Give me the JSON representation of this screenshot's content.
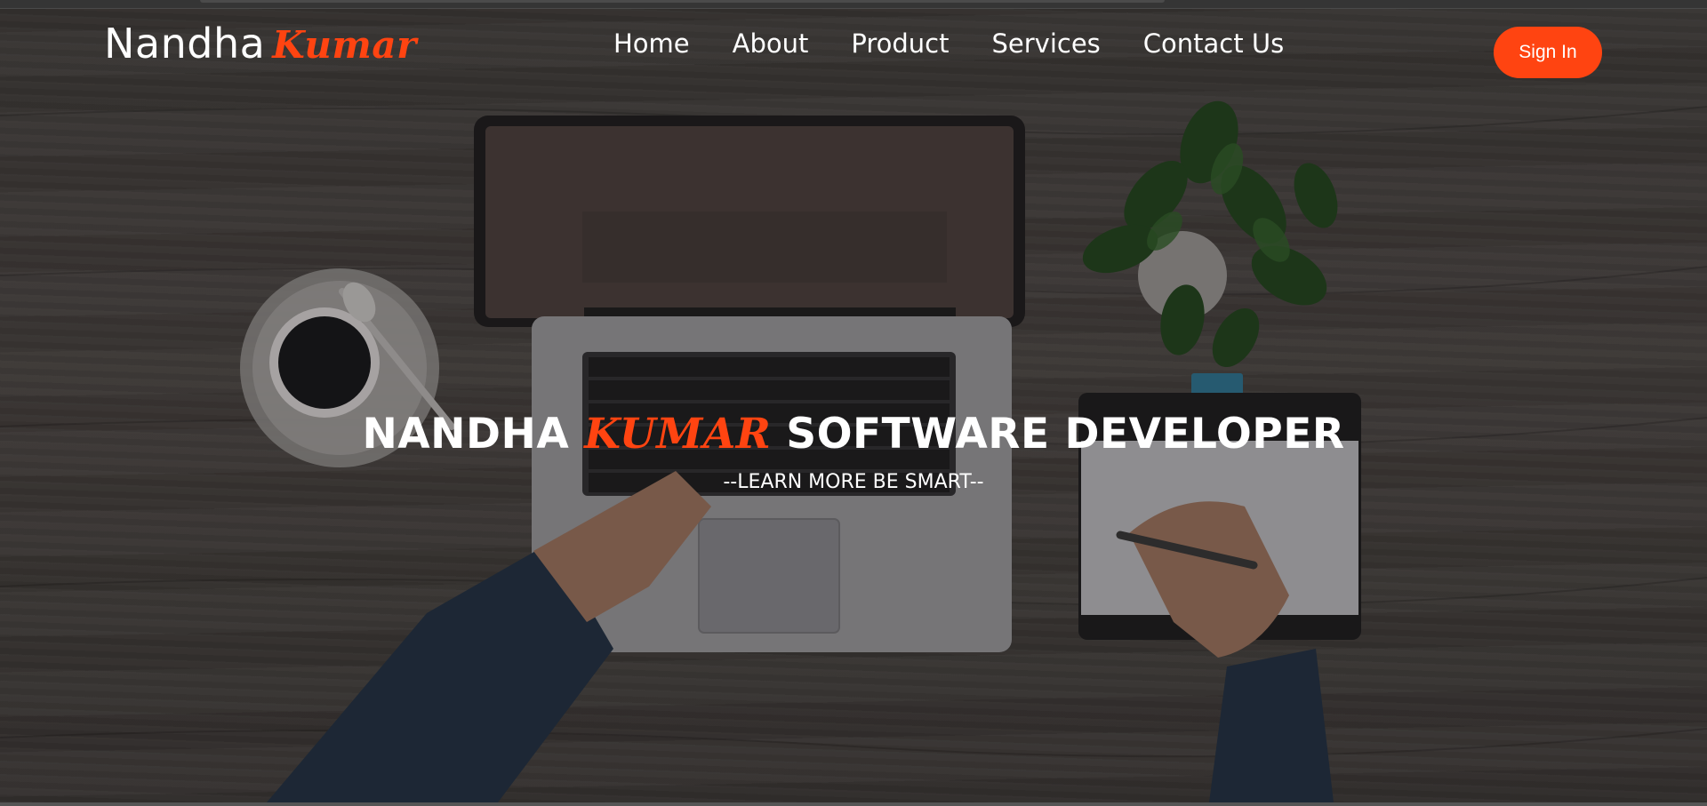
{
  "brand": {
    "first_name": "Nandha",
    "last_name": "Kumar"
  },
  "nav": {
    "items": [
      {
        "label": "Home"
      },
      {
        "label": "About"
      },
      {
        "label": "Product"
      },
      {
        "label": "Services"
      },
      {
        "label": "Contact Us"
      }
    ],
    "signin_label": "Sign In"
  },
  "hero": {
    "title_part1": "NANDHA",
    "title_accent": "KUMAR",
    "title_part2": "SOFTWARE DEVELOPER",
    "subtitle": "--LEARN MORE BE SMART--"
  },
  "colors": {
    "accent": "#ff4411",
    "text": "#ffffff",
    "background": "#3d3a38"
  }
}
